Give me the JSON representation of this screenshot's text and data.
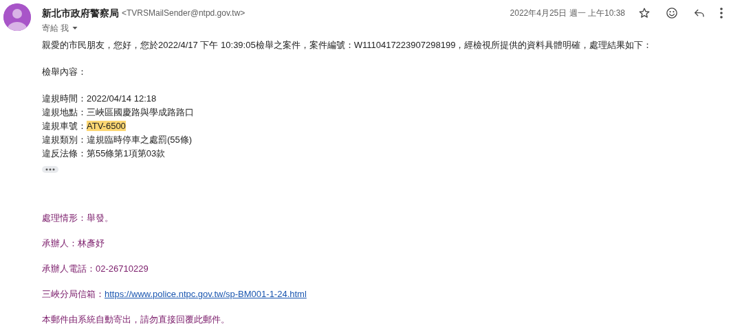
{
  "sender": {
    "name": "新北市政府警察局",
    "email": "<TVRSMailSender@ntpd.gov.tw>"
  },
  "recipient": "寄給 我",
  "date": "2022年4月25日 週一 上午10:38",
  "starred": false,
  "intro": "親愛的市民朋友，您好，您於2022/4/17 下午 10:39:05檢舉之案件，案件編號：W1110417223907298199，經檢視所提供的資料具體明確，處理結果如下：",
  "section_title": "檢舉內容：",
  "details": [
    {
      "text": "違規時間：2022/04/14 12:18"
    },
    {
      "text": "違規地點：三峽區國慶路與學成路路口"
    },
    {
      "text": "違規車號：",
      "highlight": "ATV-6500"
    },
    {
      "text": "違規類別：違規臨時停車之處罰(55條)"
    },
    {
      "text": "違反法條：第55條第1項第03款"
    }
  ],
  "results": [
    {
      "text": "處理情形：舉發。"
    },
    {
      "text": "承辦人：林彥妤"
    },
    {
      "text": "承辦人電話：02-26710229"
    },
    {
      "text": "三峽分局信箱：",
      "link": "https://www.police.ntpc.gov.tw/sp-BM001-1-24.html"
    },
    {
      "text": "本郵件由系統自動寄出，請勿直接回覆此郵件。"
    }
  ]
}
